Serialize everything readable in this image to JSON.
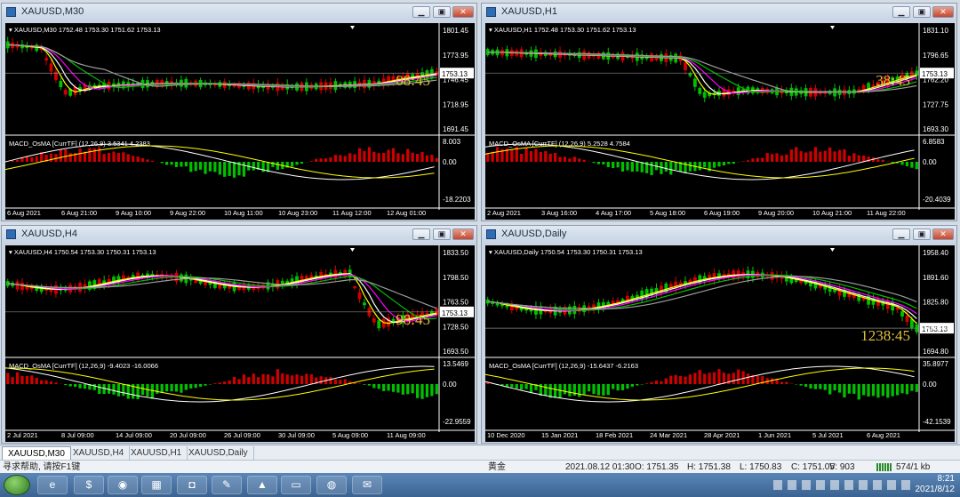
{
  "windows": [
    {
      "id": "m30",
      "title": "XAUUSD,M30",
      "info": "XAUUSD,M30  1752.48 1753.30 1751.62 1753.13",
      "countdown": "08:45",
      "price_ticks": [
        "1801.45",
        "1773.95",
        "1746.45",
        "1718.95",
        "1691.45"
      ],
      "current_price": "1753.13",
      "indicator_label": "MACD_OsMA [CurrTF] (12,26,9) 3.5341 4.2383",
      "indicator_ticks": [
        "8.003",
        "0.00",
        "-18.2203"
      ],
      "time_ticks": [
        "6 Aug 2021",
        "6 Aug 21:00",
        "9 Aug 10:00",
        "9 Aug 22:00",
        "10 Aug 11:00",
        "10 Aug 23:00",
        "11 Aug 12:00",
        "12 Aug 01:00"
      ]
    },
    {
      "id": "h1",
      "title": "XAUUSD,H1",
      "info": "XAUUSD,H1  1752.48 1753.30 1751.62 1753.13",
      "countdown": "38:45",
      "price_ticks": [
        "1831.10",
        "1796.65",
        "1762.20",
        "1727.75",
        "1693.30"
      ],
      "current_price": "1753.13",
      "indicator_label": "MACD_OsMA [CurrTF] (12,26,9) 5.2528 4.7584",
      "indicator_ticks": [
        "6.8583",
        "0.00",
        "-20.4039"
      ],
      "time_ticks": [
        "2 Aug 2021",
        "3 Aug 16:00",
        "4 Aug 17:00",
        "5 Aug 18:00",
        "6 Aug 19:00",
        "9 Aug 20:00",
        "10 Aug 21:00",
        "11 Aug 22:00"
      ]
    },
    {
      "id": "h4",
      "title": "XAUUSD,H4",
      "info": "XAUUSD,H4  1750.54 1753.30 1750.31 1753.13",
      "countdown": "98:45",
      "price_ticks": [
        "1833.50",
        "1798.50",
        "1763.50",
        "1728.50",
        "1693.50"
      ],
      "current_price": "1753.13",
      "indicator_label": "MACD_OsMA [CurrTF] (12,26,9) -9.4023 -16.0066",
      "indicator_ticks": [
        "13.5469",
        "0.00",
        "-22.9559"
      ],
      "time_ticks": [
        "2 Jul 2021",
        "8 Jul 09:00",
        "14 Jul 09:00",
        "20 Jul 09:00",
        "26 Jul 09:00",
        "30 Jul 09:00",
        "5 Aug 09:00",
        "11 Aug 09:00"
      ]
    },
    {
      "id": "d1",
      "title": "XAUUSD,Daily",
      "info": "XAUUSD,Daily  1750.54 1753.30 1750.31 1753.13",
      "countdown": "1238:45",
      "price_ticks": [
        "1958.40",
        "1891.60",
        "1825.80",
        "1759.00",
        "1694.80"
      ],
      "current_price": "1753.13",
      "indicator_label": "MACD_OsMA [CurrTF] (12,26,9) -15.6437 -6.2163",
      "indicator_ticks": [
        "35.8977",
        "0.00",
        "-42.1539"
      ],
      "time_ticks": [
        "10 Dec 2020",
        "15 Jan 2021",
        "18 Feb 2021",
        "24 Mar 2021",
        "28 Apr 2021",
        "1 Jun 2021",
        "5 Jul 2021",
        "6 Aug 2021"
      ]
    }
  ],
  "tabs": [
    "XAUUSD,M30",
    "XAUUSD,H4",
    "XAUUSD,H1",
    "XAUUSD,Daily"
  ],
  "status": {
    "help": "寻求帮助, 请按F1键",
    "profile": "黄金",
    "datetime": "2021.08.12 01:30",
    "open": "O: 1751.35",
    "high": "H: 1751.38",
    "low": "L: 1750.83",
    "close": "C: 1751.05",
    "volume": "V: 903",
    "traffic": "574/1 kb"
  },
  "clock": {
    "time": "8:21",
    "date": "2021/8/12"
  },
  "colors": {
    "bull": "#00c000",
    "bear": "#d00000",
    "countdown": "#e0c040",
    "ma_white": "#ffffff",
    "ma_yellow": "#ffff00",
    "ma_magenta": "#ff00ff",
    "ma_green": "#00c000",
    "ma_gray": "#9a9a9a"
  },
  "icons": [
    "start-orb-icon",
    "ie-icon",
    "app-icon",
    "browser-icon",
    "network-icon",
    "pen-icon",
    "camera-icon",
    "explorer-icon",
    "game-icon",
    "wechat-icon"
  ]
}
